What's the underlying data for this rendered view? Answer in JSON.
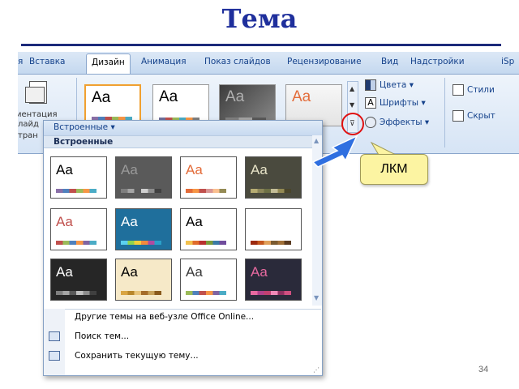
{
  "slide": {
    "title": "Тема",
    "page_number": "34",
    "callout": "ЛКМ"
  },
  "ribbon": {
    "tabs": [
      "я",
      "Вставка",
      "Дизайн",
      "Анимация",
      "Показ слайдов",
      "Рецензирование",
      "Вид",
      "Надстройки",
      "iSp"
    ],
    "active_tab": "Дизайн",
    "orientation_lines": [
      "иентация",
      "лайд",
      "тран"
    ],
    "theme_sample_text": "Aa",
    "buttons": {
      "colors": "Цвета",
      "fonts": "Шрифты",
      "effects": "Эффекты",
      "styles": "Стили",
      "hide": "Скрыт"
    }
  },
  "dropdown": {
    "header": "Встроенные",
    "section": "Встроенные",
    "theme_sample_text": "Aa",
    "themes": [
      {
        "bg": "#ffffff",
        "fg": "#000000",
        "bar": [
          "#8a6fa8",
          "#4f81bd",
          "#c0504d",
          "#9bbb59",
          "#f79646",
          "#4bacc6"
        ]
      },
      {
        "bg": "#5a5a5a",
        "fg": "#9a9a9a",
        "bar": [
          "#7f7f7f",
          "#a5a5a5",
          "#595959",
          "#cfcfcf",
          "#8c8c8c",
          "#404040"
        ]
      },
      {
        "bg": "#ffffff",
        "fg": "#e36c3a",
        "bar": [
          "#e36c3a",
          "#f79646",
          "#c0504d",
          "#d99694",
          "#fac090",
          "#948a54"
        ]
      },
      {
        "bg": "#4a4a3e",
        "fg": "#e8e4c8",
        "bar": [
          "#b6ac72",
          "#8c8659",
          "#6d7045",
          "#c4bd97",
          "#938953",
          "#4a452a"
        ]
      },
      {
        "bg": "#ffffff",
        "fg": "#c0504d",
        "bar": [
          "#c0504d",
          "#9bbb59",
          "#4f81bd",
          "#f79646",
          "#8064a2",
          "#4bacc6"
        ]
      },
      {
        "bg": "#1f6f9c",
        "fg": "#ffffff",
        "bar": [
          "#5bd0f0",
          "#8fd34e",
          "#f2cf3a",
          "#f08a3e",
          "#b04ba0",
          "#2aa0c9"
        ]
      },
      {
        "bg": "#ffffff",
        "fg": "#000000",
        "bar": [
          "#f2c14e",
          "#e06c2b",
          "#b8312f",
          "#7a9a3a",
          "#3a7aa6",
          "#704c9c"
        ]
      },
      {
        "bg": "#ffffff",
        "fg": "#ffffff",
        "bar": [
          "#9c2a10",
          "#c4561d",
          "#e0a05a",
          "#7a5a30",
          "#a07038",
          "#5a3a20"
        ]
      },
      {
        "bg": "#262626",
        "fg": "#ffffff",
        "bar": [
          "#7f7f7f",
          "#a5a5a5",
          "#595959",
          "#bfbfbf",
          "#8c8c8c",
          "#404040"
        ]
      },
      {
        "bg": "#f6e9c8",
        "fg": "#000000",
        "bar": [
          "#d9a441",
          "#b8862b",
          "#e8c47a",
          "#a56c2a",
          "#c9a35b",
          "#8a5a1c"
        ]
      },
      {
        "bg": "#ffffff",
        "fg": "#3a3a3a",
        "bar": [
          "#9bbb59",
          "#4f81bd",
          "#c0504d",
          "#f79646",
          "#8064a2",
          "#4bacc6"
        ]
      },
      {
        "bg": "#2a2a3a",
        "fg": "#e86aa0",
        "bar": [
          "#e86aa0",
          "#b0408a",
          "#c04070",
          "#f08ab8",
          "#903060",
          "#d05080"
        ]
      }
    ],
    "menu_items": [
      "Другие темы на веб-узле Office Online...",
      "Поиск тем...",
      "Сохранить текущую тему..."
    ]
  }
}
